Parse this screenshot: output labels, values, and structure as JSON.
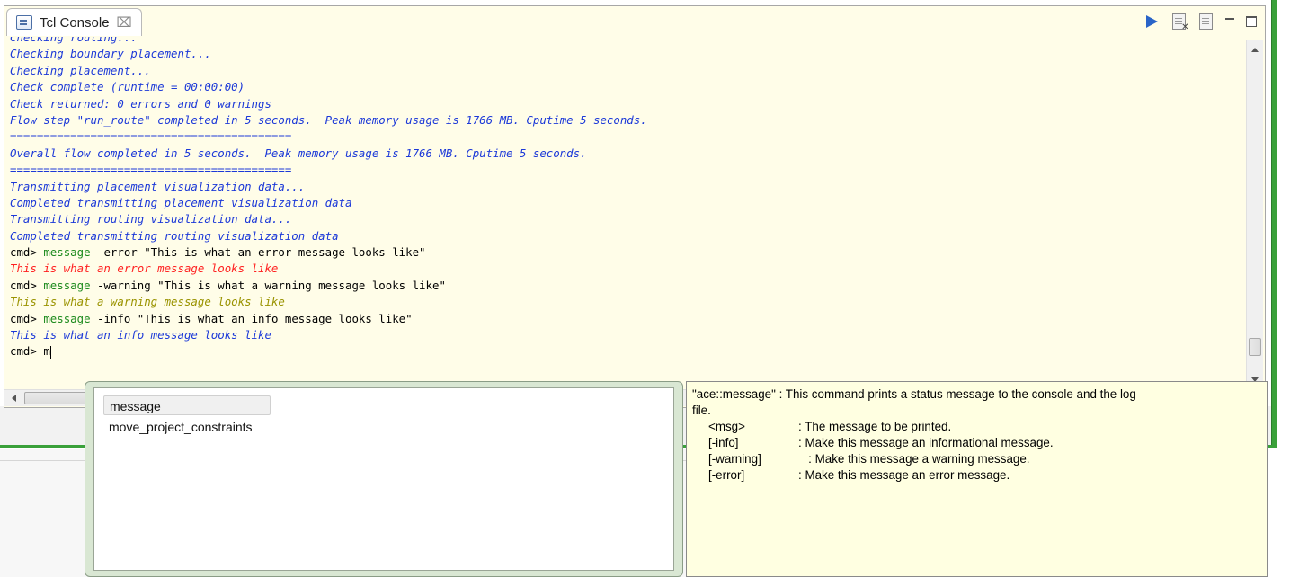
{
  "view": {
    "tab_label": "Tcl Console",
    "tab_close": "⌧"
  },
  "toolbar": {
    "run_icon": "run-icon",
    "clear_icon": "clear-console-icon",
    "document_icon": "document-icon",
    "minimize_icon": "minimize-icon",
    "maximize_icon": "maximize-icon"
  },
  "console": {
    "lines": [
      {
        "text": "Checking routing...",
        "kind": "out"
      },
      {
        "text": "Checking boundary placement...",
        "kind": "out"
      },
      {
        "text": "Checking placement...",
        "kind": "out"
      },
      {
        "text": "Check complete (runtime = 00:00:00)",
        "kind": "out"
      },
      {
        "text": "Check returned: 0 errors and 0 warnings",
        "kind": "out"
      },
      {
        "text": "Flow step \"run_route\" completed in 5 seconds.  Peak memory usage is 1766 MB. Cputime 5 seconds.",
        "kind": "out"
      },
      {
        "text": "==========================================",
        "kind": "out"
      },
      {
        "text": "Overall flow completed in 5 seconds.  Peak memory usage is 1766 MB. Cputime 5 seconds.",
        "kind": "out"
      },
      {
        "text": "==========================================",
        "kind": "out"
      },
      {
        "text": "Transmitting placement visualization data...",
        "kind": "out"
      },
      {
        "text": "Completed transmitting placement visualization data",
        "kind": "out"
      },
      {
        "text": "Transmitting routing visualization data...",
        "kind": "out"
      },
      {
        "text": "Completed transmitting routing visualization data",
        "kind": "out"
      },
      {
        "prompt": "cmd> ",
        "keyword": "message",
        "args": " -error \"This is what an error message looks like\"",
        "kind": "cmd"
      },
      {
        "text": "This is what an error message looks like",
        "kind": "err"
      },
      {
        "prompt": "cmd> ",
        "keyword": "message",
        "args": " -warning \"This is what a warning message looks like\"",
        "kind": "cmd"
      },
      {
        "text": "This is what a warning message looks like",
        "kind": "warn"
      },
      {
        "prompt": "cmd> ",
        "keyword": "message",
        "args": " -info \"This is what an info message looks like\"",
        "kind": "cmd"
      },
      {
        "text": "This is what an info message looks like",
        "kind": "info"
      }
    ],
    "input_prompt": "cmd> ",
    "input_value": "m"
  },
  "completion": {
    "items": [
      "message",
      "move_project_constraints"
    ],
    "selected_index": 0
  },
  "doc": {
    "heading": "\"ace::message\" : This command prints a status message to the console and the log",
    "heading_cont": "file.",
    "args": [
      {
        "name": "<msg>",
        "desc": ": The message to be printed."
      },
      {
        "name": "[-info]",
        "desc": ": Make this message an informational message."
      },
      {
        "name": "[-warning]",
        "desc": "   : Make this message a warning message."
      },
      {
        "name": "[-error]",
        "desc": ": Make this message an error message."
      }
    ]
  },
  "colors": {
    "output": "#1c39d8",
    "error": "#ff2020",
    "warning": "#9a9300",
    "keyword": "#1c8a1c",
    "console_bg": "#fffde8",
    "tooltip_bg": "#ffffe1"
  }
}
